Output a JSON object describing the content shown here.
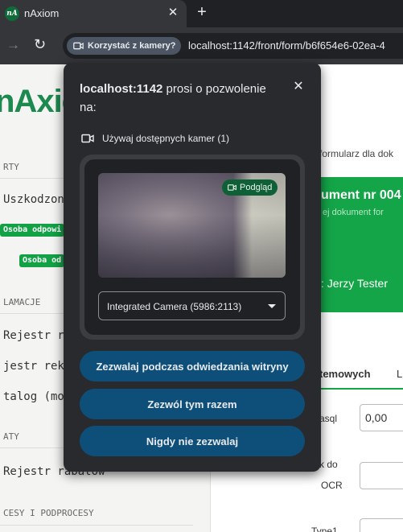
{
  "browser": {
    "tab_title": "nAxiom",
    "favicon_text": "nA",
    "camera_chip_label": "Korzystać z kamery?",
    "url": "localhost:1142/front/form/b6f654e6-02ea-4"
  },
  "app": {
    "logo": "nAxiom",
    "sidebar": {
      "section_1": "RTY",
      "item_1": "Uszkodzon",
      "badge_1": "Osoba odpowi",
      "badge_2": "Osoba od",
      "section_2": "LAMACJE",
      "item_2": "Rejestr r",
      "item_3": "jestr rekl",
      "item_4": "talog (mod",
      "section_3": "ATY",
      "item_5": "Rejestr rabatów",
      "section_4": "CESY I PODPROCESY"
    },
    "form": {
      "hint": "formularz dla dok",
      "card_title": "ument nr 004",
      "card_subtitle": "ej dokument for",
      "card_user": ": Jerzy Tester",
      "tab_1": "temowych",
      "tab_2": "L",
      "field_1_label": "asql",
      "field_1_value": "0,00",
      "field_2_label_1": "k do",
      "field_2_label_2": "OCR",
      "field_3_label": "Type1"
    }
  },
  "dialog": {
    "host": "localhost:1142",
    "title_rest": " prosi o pozwolenie na:",
    "permission": "Używaj dostępnych kamer (1)",
    "preview_label": "Podgląd",
    "camera_option": "Integrated Camera (5986:2113)",
    "buttons": {
      "allow_on_visit": "Zezwalaj podczas odwiedzania witryny",
      "allow_once": "Zezwól tym razem",
      "never": "Nigdy nie zezwalaj"
    }
  },
  "colors": {
    "accent_green": "#14a548",
    "dialog_bg": "#292a2d",
    "button_blue": "#0e4f7a"
  }
}
